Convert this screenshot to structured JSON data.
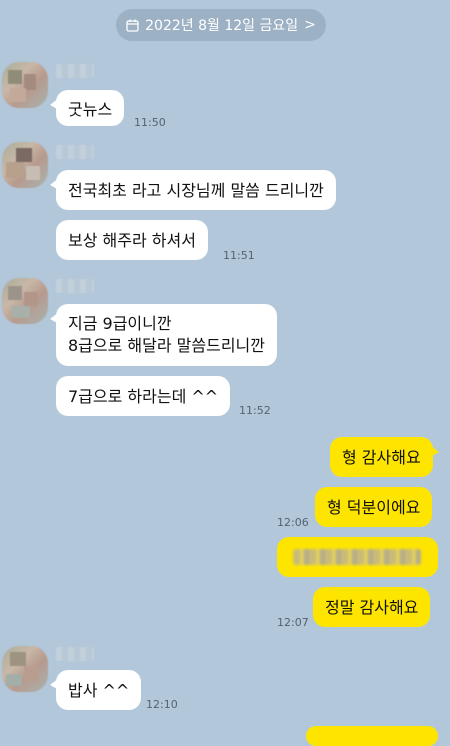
{
  "date_divider": {
    "label": "2022년 8월 12일 금요일",
    "chevron": ">",
    "icon": "calendar-icon"
  },
  "colors": {
    "background": "#b2c7da",
    "incoming_bubble": "#ffffff",
    "outgoing_bubble": "#fee500"
  },
  "messages": [
    {
      "side": "in",
      "text": "굿뉴스",
      "time": "11:50"
    },
    {
      "side": "in",
      "text": "전국최초 라고 시장님께 말씀 드리니깐"
    },
    {
      "side": "in",
      "text": "보상 해주라 하셔서",
      "time": "11:51"
    },
    {
      "side": "in",
      "text": "지금 9급이니깐\n8급으로 해달라 말씀드리니깐"
    },
    {
      "side": "in",
      "text": "7급으로 하라는데 ^^",
      "time": "11:52"
    },
    {
      "side": "out",
      "text": "형 감사해요"
    },
    {
      "side": "out",
      "text": "형 덕분이에요",
      "time": "12:06"
    },
    {
      "side": "out",
      "text": ""
    },
    {
      "side": "out",
      "text": "정말 감사해요",
      "time": "12:07"
    },
    {
      "side": "in",
      "text": "밥사 ^^",
      "time": "12:10"
    }
  ]
}
